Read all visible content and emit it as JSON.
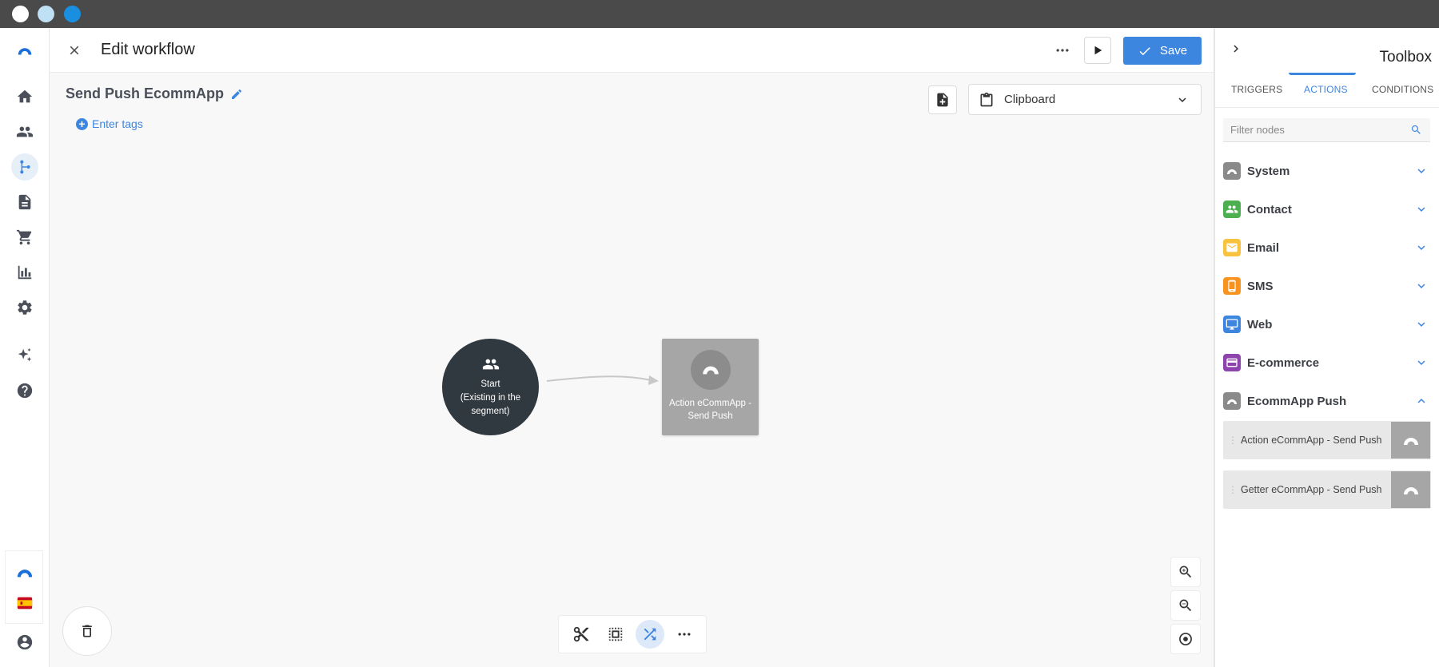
{
  "header": {
    "title": "Edit workflow",
    "save_label": "Save"
  },
  "workflow": {
    "name": "Send Push EcommApp",
    "tags_link": "Enter tags",
    "clipboard_label": "Clipboard"
  },
  "nodes": {
    "start_title": "Start",
    "start_line2": "(Existing in the",
    "start_line3": "segment)",
    "action_line1": "Action eCommApp -",
    "action_line2": "Send Push"
  },
  "toolbox": {
    "title": "Toolbox",
    "tabs": [
      "TRIGGERS",
      "ACTIONS",
      "CONDITIONS"
    ],
    "active_tab": "ACTIONS",
    "filter_placeholder": "Filter nodes",
    "categories": [
      {
        "label": "System",
        "color": "#8a8a8a",
        "icon": "ecomm-logo-icon"
      },
      {
        "label": "Contact",
        "color": "#4caf50",
        "icon": "people-icon"
      },
      {
        "label": "Email",
        "color": "#f9c23c",
        "icon": "envelope-icon"
      },
      {
        "label": "SMS",
        "color": "#f7931e",
        "icon": "phone-icon"
      },
      {
        "label": "Web",
        "color": "#3d86e0",
        "icon": "monitor-icon"
      },
      {
        "label": "E-commerce",
        "color": "#8e44ad",
        "icon": "card-icon"
      },
      {
        "label": "EcommApp Push",
        "color": "#8a8a8a",
        "icon": "ecomm-logo-icon"
      }
    ],
    "push_nodes": [
      "Action eCommApp - Send Push",
      "Getter eCommApp - Send Push"
    ]
  },
  "colors": {
    "accent": "#3d86e0",
    "start_node": "#303840",
    "action_node": "#a6a6a6"
  }
}
